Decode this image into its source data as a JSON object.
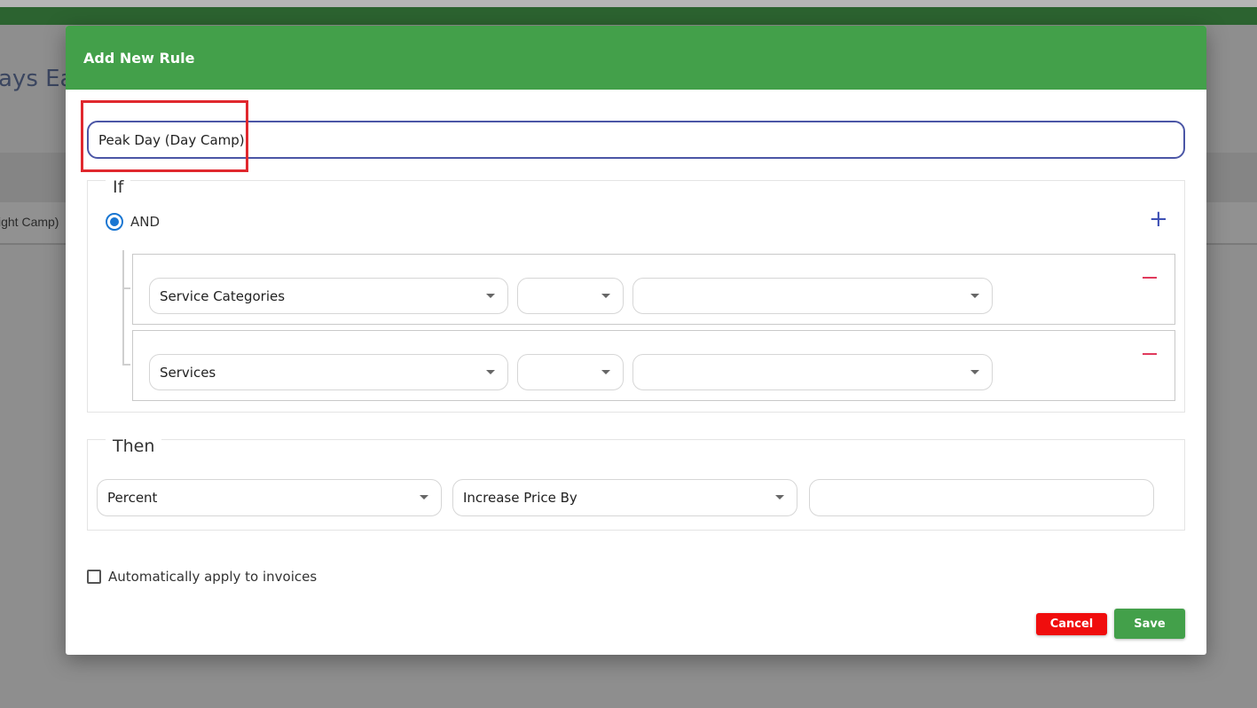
{
  "background": {
    "heading_fragment": "ays Ear",
    "row_fragment": "ight Camp)"
  },
  "modal": {
    "title": "Add New Rule",
    "rule_name_value": "Peak Day (Day Camp)",
    "if_section": {
      "legend": "If",
      "operator_label": "AND",
      "conditions": [
        {
          "field": "Service Categories",
          "operator": "",
          "value": ""
        },
        {
          "field": "Services",
          "operator": "",
          "value": ""
        }
      ]
    },
    "then_section": {
      "legend": "Then",
      "type": "Percent",
      "action": "Increase Price By",
      "amount": ""
    },
    "auto_apply_label": "Automatically apply to invoices",
    "auto_apply_checked": false,
    "cancel_label": "Cancel",
    "save_label": "Save"
  },
  "colors": {
    "header_green": "#43a04a",
    "cancel_red": "#f00d0d",
    "highlight_red": "#e0282e",
    "radio_blue": "#1976d2",
    "minus_pink": "#e03a5c"
  },
  "icons": [
    "plus-icon",
    "minus-icon",
    "chevron-down-icon",
    "radio-checked-icon",
    "checkbox-icon"
  ]
}
